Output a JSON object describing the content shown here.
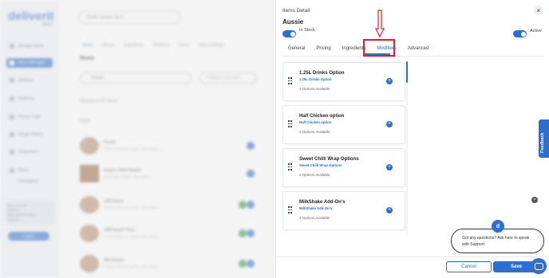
{
  "background": {
    "logo": "deliverit",
    "logo_sub": "INNO",
    "nav": [
      {
        "label": "Manage Menu"
      },
      {
        "label": "Menu Manager"
      },
      {
        "label": "Settings"
      },
      {
        "label": "Ordering"
      },
      {
        "label": "Promo Code"
      },
      {
        "label": "Usage History"
      },
      {
        "label": "Integrations"
      },
      {
        "label": "Menu"
      },
      {
        "label": "Translations"
      }
    ],
    "side_info": [
      "Menu Section",
      "Sections",
      "Menu Added Section",
      "Sections"
    ],
    "side_button": "Logout",
    "store_select": "Studio Sample Store",
    "tabs": [
      "Items",
      "Menus",
      "Ingredients",
      "Modifiers",
      "Deals",
      "Menu Settings"
    ],
    "items_title": "Items",
    "search_value": "Aussie",
    "filter_placeholder": "Category Selected",
    "showing": "Showing 6 of 6 Items",
    "name_header": "Name",
    "rows": [
      {
        "name": "Aussie",
        "sub": "Tomato Sauce & Cheese, Ham, Bacon..."
      },
      {
        "name": "Aussie Grilled Burger",
        "sub": "Beef Patty, Cheese, Ham, Bacon..."
      },
      {
        "name": "LBB Aussie",
        "sub": "Tomato Sauce & Cheese, Ham, Bacon..."
      },
      {
        "name": "LBB Aussie Pizza",
        "sub": "Tomato Sauce & Cheese, Ham, Bacon..."
      },
      {
        "name": "Mini Aussie",
        "sub": "Tomato Sauce & Cheese, Ham, Bacon..."
      }
    ]
  },
  "panel": {
    "title": "Items Detail",
    "close_icon": "×",
    "item_name": "Aussie",
    "in_stock_label": "In Stock",
    "active_label": "Active",
    "tabs": [
      {
        "label": "General"
      },
      {
        "label": "Pricing"
      },
      {
        "label": "Ingredients"
      },
      {
        "label": "Modifiers"
      },
      {
        "label": "Advanced"
      }
    ],
    "active_tab": "Modifiers",
    "modifiers": [
      {
        "title": "1.25L Drinks Option",
        "subtitle": "1.25L Drinks Option",
        "count": "4 Options Available"
      },
      {
        "title": "Half Chicken option",
        "subtitle": "Half Chicken option",
        "count": "2 Options Available"
      },
      {
        "title": "Sweet Chilli Wrap Options",
        "subtitle": "Sweet Chilli Wrap Options",
        "count": "2 Options Available"
      },
      {
        "title": "MilkShake Add-On's",
        "subtitle": "MilkShake Add-On's",
        "count": "4 Options Available"
      }
    ],
    "add_icon": "+",
    "cancel_label": "Cancel",
    "save_label": "Save"
  },
  "feedback_label": "Feedback",
  "chat": {
    "avatar_letter": "d",
    "close_icon": "×",
    "message": "Got any questions? Ask here to speak with Support."
  },
  "colors": {
    "accent": "#2c6fd1",
    "highlight": "#e0202a"
  }
}
